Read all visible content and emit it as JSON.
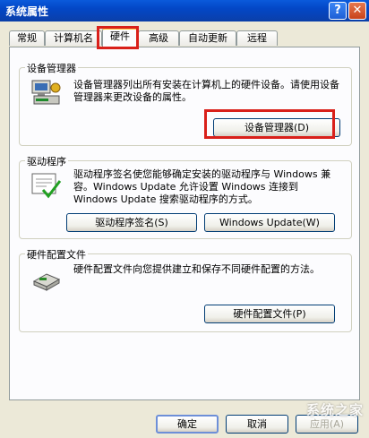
{
  "window": {
    "title": "系统属性",
    "help_label": "?",
    "close_label": "✕"
  },
  "tabs": [
    {
      "label": "常规"
    },
    {
      "label": "计算机名"
    },
    {
      "label": "硬件"
    },
    {
      "label": "高级"
    },
    {
      "label": "自动更新"
    },
    {
      "label": "远程"
    }
  ],
  "device_manager": {
    "title": "设备管理器",
    "description": "设备管理器列出所有安装在计算机上的硬件设备。请使用设备管理器来更改设备的属性。",
    "button": "设备管理器(D)"
  },
  "drivers": {
    "title": "驱动程序",
    "description": "驱动程序签名使您能够确定安装的驱动程序与 Windows 兼容。Windows Update 允许设置 Windows 连接到 Windows Update 搜索驱动程序的方式。",
    "signing_button": "驱动程序签名(S)",
    "update_button": "Windows Update(W)"
  },
  "hardware_profiles": {
    "title": "硬件配置文件",
    "description": "硬件配置文件向您提供建立和保存不同硬件配置的方法。",
    "button": "硬件配置文件(P)"
  },
  "footer": {
    "ok": "确定",
    "cancel": "取消",
    "apply": "应用(A)"
  },
  "watermark": "系统之家"
}
